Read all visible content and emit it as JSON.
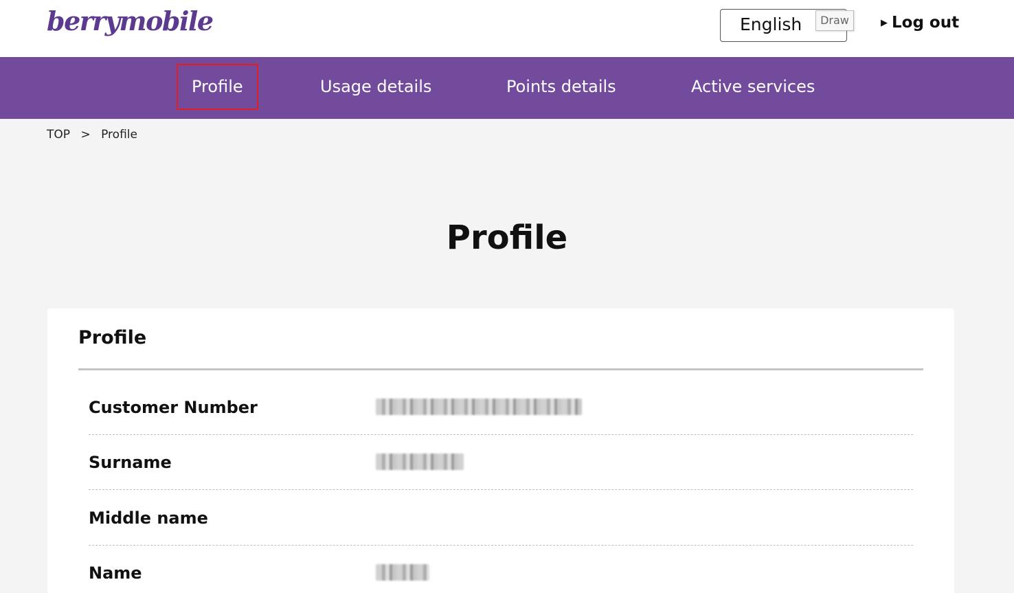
{
  "header": {
    "logo": "berrymobile",
    "language": "English",
    "draw_tag": "Draw",
    "logout": "Log out"
  },
  "nav": {
    "items": [
      {
        "label": "Profile",
        "active": true
      },
      {
        "label": "Usage details"
      },
      {
        "label": "Points details"
      },
      {
        "label": "Active services"
      }
    ]
  },
  "breadcrumb": {
    "top": "TOP",
    "separator": ">",
    "current": "Profile"
  },
  "page": {
    "title": "Profile"
  },
  "card": {
    "title": "Profile",
    "rows": [
      {
        "label": "Customer Number",
        "value_redacted": true
      },
      {
        "label": "Surname",
        "value_redacted": true
      },
      {
        "label": "Middle name",
        "value_redacted": false
      },
      {
        "label": "Name",
        "value_redacted": true
      }
    ]
  },
  "colors": {
    "brand_purple": "#734b9c",
    "logo_purple": "#5b3a8f",
    "active_outline": "#e02020",
    "page_background": "#f4f4f4"
  }
}
